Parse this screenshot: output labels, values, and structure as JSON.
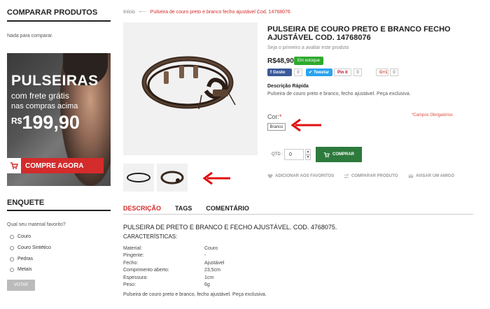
{
  "sidebar": {
    "compare_title": "COMPARAR PRODUTOS",
    "compare_empty": "Nada para comparar.",
    "banner": {
      "line1": "PULSEIRAS",
      "line2": "com frete grátis",
      "line3": "nas compras acima",
      "currency": "R$",
      "price": "199,90",
      "cta": "COMPRE AGORA"
    },
    "poll_title": "ENQUETE",
    "poll_question": "Qual seu material favorito?",
    "poll_options": [
      "Couro",
      "Couro Sintético",
      "Pedras",
      "Metais"
    ],
    "vote_label": "VOTAR"
  },
  "breadcrumb": {
    "home": "Início",
    "separator": "⟵",
    "current": "Pulseira de couro preto e branco fecho ajustável Cod. 14768076"
  },
  "product": {
    "title": "PULSEIRA DE COURO PRETO E BRANCO FECHO AJUSTÁVEL COD. 14768076",
    "review": "Seja o primeiro a avaliar este produto",
    "price": "R$48,90",
    "stock": "Em estoque",
    "social": {
      "fb": "Gosto",
      "fb_count": "0",
      "tw": "Tweetar",
      "pin": "Pin it",
      "pin_count": "0",
      "gp": "G+1",
      "gp_count": "0"
    },
    "desc_heading": "Descrição Rápida",
    "desc_text": "Pulseira de couro preto e branco, fecho ajustável. Peça exclusiva.",
    "color_label": "Cor:",
    "required_mark": "*",
    "required_fields": "*Campos Obrigatórios",
    "color_option": "Branco",
    "qty_label": "QTD :",
    "qty_value": "0",
    "buy_label": "COMPRAR",
    "links": {
      "favorites": "ADICIONAR AOS FAVORITOS",
      "compare": "COMPARAR PRODUTO",
      "share": "AVISAR UM AMIGO"
    }
  },
  "tabs": [
    "DESCRIÇÃO",
    "TAGS",
    "COMENTÁRIO"
  ],
  "description": {
    "title": "PULSEIRA DE PRETO E BRANCO E FECHO AJUSTÁVEL. COD. 4768075.",
    "subtitle": "CARACTERÍSTICAS:",
    "specs": [
      {
        "k": "Material:",
        "v": "Couro"
      },
      {
        "k": "Pingente:",
        "v": "-"
      },
      {
        "k": "Fecho:",
        "v": "Ajustável"
      },
      {
        "k": "Comprimento aberto:",
        "v": "23,5cm"
      },
      {
        "k": "Espessura:",
        "v": "1cm"
      },
      {
        "k": "Peso:",
        "v": "6g"
      }
    ],
    "footer": "Pulseira de couro preto e branco, fecho ajustável. Peça exclusiva."
  },
  "colors": {
    "accent_red": "#d42b2b",
    "buy_green": "#2d7a3c",
    "stock_green": "#2eaa2e"
  }
}
